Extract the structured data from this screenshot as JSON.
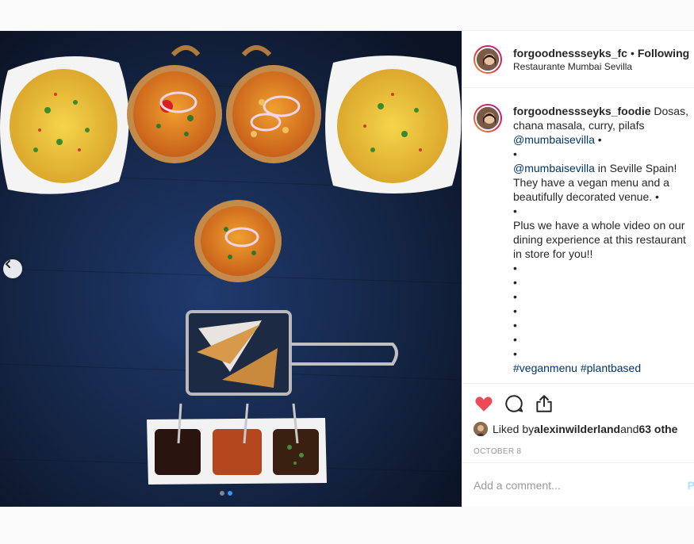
{
  "header": {
    "username": "forgoodnessseyks_fc",
    "separator": "•",
    "follow_status": "Following",
    "location": "Restaurante Mumbai Sevilla"
  },
  "caption": {
    "username": "forgoodnessseyks_foodie",
    "line1_text": " Dosas,",
    "line2": "chana masala, curry, pilafs",
    "mention1": "@mumbaisevilla",
    "line3_after": " •",
    "bullet": "•",
    "mention2": "@mumbaisevilla",
    "line5_after": " in Seville Spain!",
    "line6": "They have a vegan menu and a",
    "line7": "beautifully decorated venue. •",
    "line9": "Plus we have a whole video on our",
    "line10": "dining experience at this restaurant",
    "line11": "in store for you!!",
    "hashtag1": "#veganmenu",
    "hashtag2": "#plantbased"
  },
  "actions": {
    "like_icon": "heart-icon",
    "comment_icon": "comment-icon",
    "share_icon": "share-icon",
    "liked_by_prefix": "Liked by ",
    "liked_by_user": "alexinwilderland",
    "liked_by_and": " and ",
    "liked_by_others": "63 othe",
    "date": "OCTOBER 8"
  },
  "comment": {
    "placeholder": "Add a comment...",
    "post_label": "P"
  },
  "colors": {
    "like_red": "#ed4956",
    "link_blue": "#003569",
    "story_ring": "#dc2743"
  }
}
